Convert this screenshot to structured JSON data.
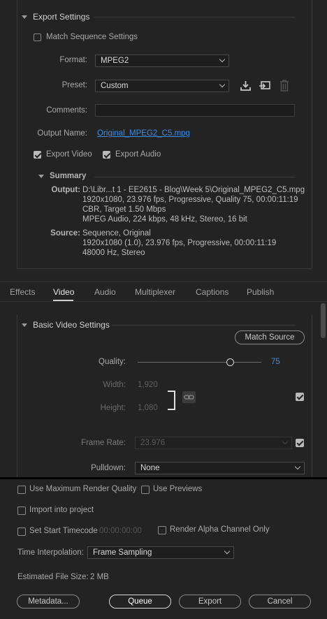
{
  "export_settings": {
    "title": "Export Settings",
    "match_sequence": "Match Sequence Settings",
    "format_label": "Format:",
    "format_value": "MPEG2",
    "preset_label": "Preset:",
    "preset_value": "Custom",
    "comments_label": "Comments:",
    "output_name_label": "Output Name:",
    "output_name_value": "Original_MPEG2_C5.mpg",
    "export_video": "Export Video",
    "export_audio": "Export Audio",
    "export_video_checked": true,
    "export_audio_checked": true,
    "match_sequence_checked": false
  },
  "summary": {
    "title": "Summary",
    "output_label": "Output:",
    "output_lines": [
      "D:\\Libr...t 1 - EE2615 - Blog\\Week 5\\Original_MPEG2_C5.mpg",
      "1920x1080, 23.976 fps, Progressive, Quality 75, 00:00:11:19",
      "CBR, Target 1.50 Mbps",
      "MPEG Audio, 224 kbps, 48 kHz, Stereo, 16 bit"
    ],
    "source_label": "Source:",
    "source_lines": [
      "Sequence, Original",
      "1920x1080 (1.0), 23.976 fps, Progressive, 00:00:11:19",
      "48000 Hz, Stereo"
    ]
  },
  "tabs": [
    {
      "label": "Effects",
      "active": false
    },
    {
      "label": "Video",
      "active": true
    },
    {
      "label": "Audio",
      "active": false
    },
    {
      "label": "Multiplexer",
      "active": false
    },
    {
      "label": "Captions",
      "active": false
    },
    {
      "label": "Publish",
      "active": false
    }
  ],
  "video": {
    "title": "Basic Video Settings",
    "match_source": "Match Source",
    "quality_label": "Quality:",
    "quality_value": "75",
    "quality_fraction": 0.75,
    "width_label": "Width:",
    "width_value": "1,920",
    "height_label": "Height:",
    "height_value": "1,080",
    "frame_rate_label": "Frame Rate:",
    "frame_rate_value": "23.976",
    "pulldown_label": "Pulldown:",
    "pulldown_value": "None"
  },
  "bottom": {
    "max_render": "Use Maximum Render Quality",
    "use_previews": "Use Previews",
    "import_project": "Import into project",
    "set_start_tc": "Set Start Timecode",
    "start_tc_value": "00:00:00:00",
    "render_alpha": "Render Alpha Channel Only",
    "time_interp_label": "Time Interpolation:",
    "time_interp_value": "Frame Sampling",
    "file_size_label": "Estimated File Size:",
    "file_size_value": "2 MB",
    "metadata_btn": "Metadata...",
    "queue_btn": "Queue",
    "export_btn": "Export",
    "cancel_btn": "Cancel"
  },
  "colors": {
    "background": "#232323",
    "accent": "#3a8ee6",
    "separator": "#000000"
  }
}
